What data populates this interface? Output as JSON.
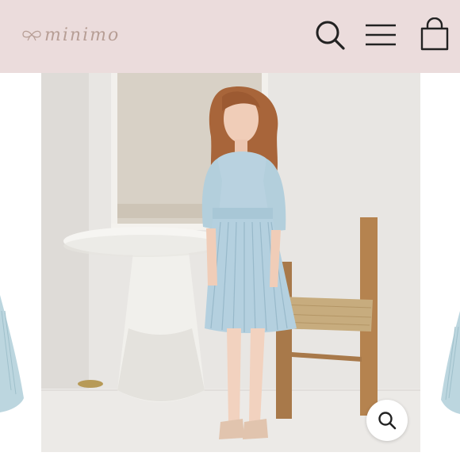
{
  "header": {
    "brand_name": "minimo",
    "icons": [
      "search-icon",
      "hamburger-menu-icon",
      "shopping-bag-icon"
    ],
    "background_color": "#ebdcdc",
    "icon_color": "#222222",
    "brand_color": "#b79e95"
  },
  "gallery": {
    "main_image": "girl-in-blue-pleated-dress-photo",
    "zoom_icon": "zoom-magnifier-icon"
  }
}
